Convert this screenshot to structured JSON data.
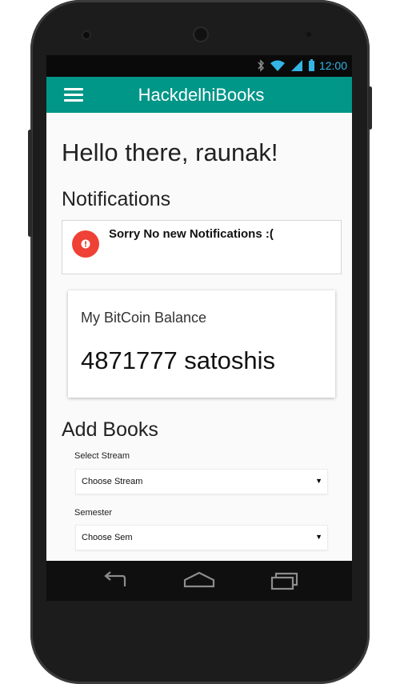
{
  "status_bar": {
    "time": "12:00",
    "icons": [
      "bluetooth-icon",
      "wifi-icon",
      "signal-icon",
      "battery-icon"
    ]
  },
  "app_bar": {
    "title": "HackdelhiBooks",
    "menu_icon": "hamburger-menu-icon",
    "color": "#009688"
  },
  "greeting": "Hello there, raunak!",
  "notifications": {
    "heading": "Notifications",
    "message": "Sorry No new Notifications :(",
    "icon": "alert-icon",
    "icon_color": "#ef4136"
  },
  "bitcoin": {
    "label": "My BitCoin Balance",
    "balance": "4871777 satoshis"
  },
  "add_books": {
    "heading": "Add Books",
    "stream": {
      "label": "Select Stream",
      "value": "Choose Stream"
    },
    "semester": {
      "label": "Semester",
      "value": "Choose Sem"
    }
  },
  "nav_bar": {
    "icons": [
      "back-icon",
      "home-icon",
      "recents-icon"
    ]
  }
}
